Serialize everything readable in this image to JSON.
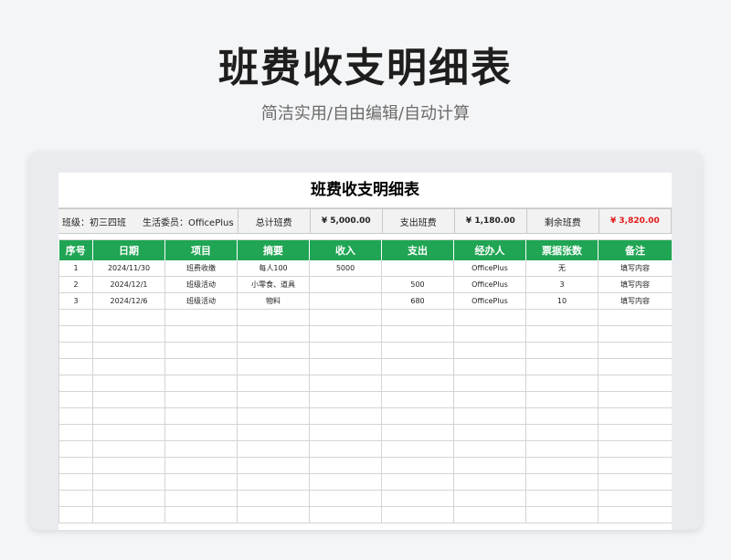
{
  "header": {
    "title": "班费收支明细表",
    "subtitle": "简洁实用/自由编辑/自动计算"
  },
  "sheet": {
    "title": "班费收支明细表",
    "summary": {
      "class_label": "班级：初三四班",
      "committee_label": "生活委员：OfficePlus",
      "total_label": "总计班费",
      "total_value": "¥ 5,000.00",
      "expense_label": "支出班费",
      "expense_value": "¥ 1,180.00",
      "remain_label": "剩余班费",
      "remain_value": "¥ 3,820.00"
    },
    "columns": [
      "序号",
      "日期",
      "项目",
      "摘要",
      "收入",
      "支出",
      "经办人",
      "票据张数",
      "备注"
    ],
    "rows": [
      [
        "1",
        "2024/11/30",
        "班费收缴",
        "每人100",
        "5000",
        "",
        "OfficePlus",
        "无",
        "填写内容"
      ],
      [
        "2",
        "2024/12/1",
        "班级活动",
        "小零食、道具",
        "",
        "500",
        "OfficePlus",
        "3",
        "填写内容"
      ],
      [
        "3",
        "2024/12/6",
        "班级活动",
        "物料",
        "",
        "680",
        "OfficePlus",
        "10",
        "填写内容"
      ]
    ],
    "empty_rows": 13
  },
  "colors": {
    "header_green": "#1fa553",
    "remain_red": "#e31b1b"
  }
}
